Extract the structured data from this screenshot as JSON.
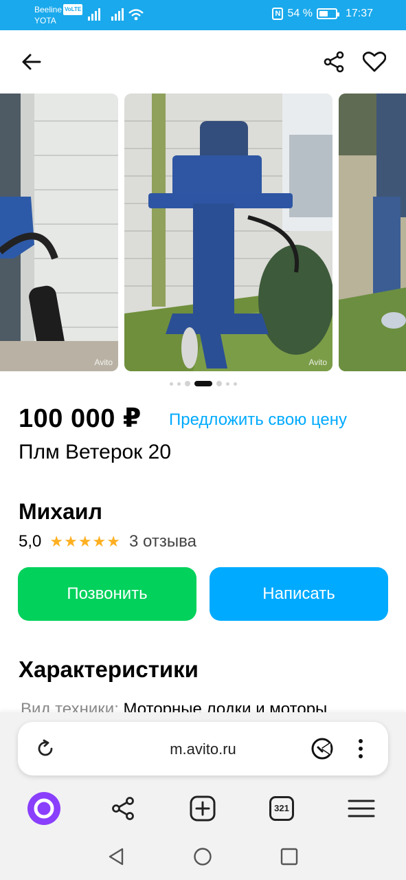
{
  "status_bar": {
    "carrier_1": "Beeline",
    "volte": "VoLTE",
    "carrier_2": "YOTA",
    "nfc": "N",
    "battery_percent": "54 %",
    "battery_level": 0.54,
    "time": "17:37"
  },
  "header": {
    "back_icon": "arrow-left-icon",
    "share_icon": "share-icon",
    "favorite_icon": "heart-icon"
  },
  "gallery": {
    "watermark": "Avito",
    "photo_count_visible": 3,
    "active_index": 3
  },
  "listing": {
    "price": "100 000 ₽",
    "offer_link": "Предложить свою цену",
    "title": "Плм Ветерок 20"
  },
  "seller": {
    "name": "Михаил",
    "rating": "5,0",
    "stars": "★★★★★",
    "reviews": "3 отзыва"
  },
  "actions": {
    "call": "Позвонить",
    "write": "Написать"
  },
  "specs": {
    "heading": "Характеристики",
    "row_key": "Вид техники: ",
    "row_value": "Моторные лодки и моторы"
  },
  "browser": {
    "url": "m.avito.ru",
    "tabs_count": "321",
    "colors": {
      "alice": "#8a3ffc",
      "accent": "#00aaff",
      "green": "#02d15c",
      "status": "#1aa9ec"
    }
  }
}
